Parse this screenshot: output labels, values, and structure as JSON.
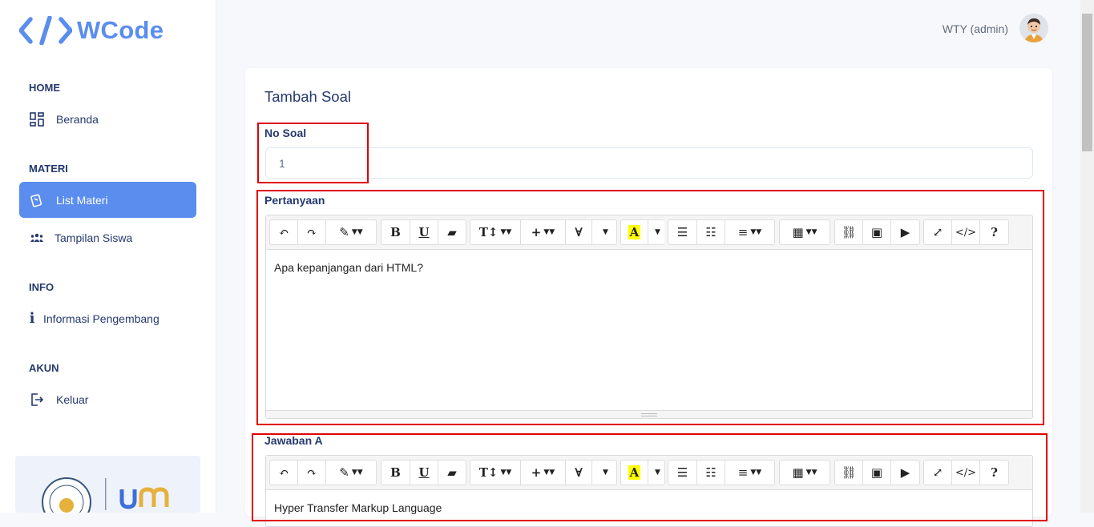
{
  "brand": {
    "name": "WCode",
    "accent": "#5a8dee"
  },
  "sidebar": {
    "sections": [
      {
        "title": "HOME"
      },
      {
        "title": "MATERI"
      },
      {
        "title": "INFO"
      },
      {
        "title": "AKUN"
      }
    ],
    "items": [
      {
        "label": "Beranda",
        "icon": "grid-icon"
      },
      {
        "label": "List Materi",
        "icon": "cards-icon",
        "active": true
      },
      {
        "label": "Tampilan Siswa",
        "icon": "users-icon"
      },
      {
        "label": "Informasi Pengembang",
        "icon": "info-icon"
      },
      {
        "label": "Keluar",
        "icon": "logout-icon"
      }
    ]
  },
  "header": {
    "user": "WTY (admin)"
  },
  "form": {
    "title": "Tambah Soal",
    "no_soal_label": "No Soal",
    "no_soal_value": "1",
    "pertanyaan_label": "Pertanyaan",
    "pertanyaan_text": "Apa kepanjangan dari HTML?",
    "jawaban_a_label": "Jawaban A",
    "jawaban_a_text": "Hyper Transfer Markup Language"
  },
  "toolbar": {
    "undo": "↶",
    "redo": "↷",
    "style": "✎",
    "bold": "B",
    "underline": "U",
    "clear": "▰",
    "fontsize": "T↕",
    "plus": "+",
    "forall": "∀",
    "color": "A",
    "ul": "☰",
    "ol": "☷",
    "align": "≡",
    "table": "▦",
    "link": "⛓",
    "image": "▣",
    "video": "▶",
    "fullscreen": "⤢",
    "code": "</>",
    "help": "?"
  }
}
